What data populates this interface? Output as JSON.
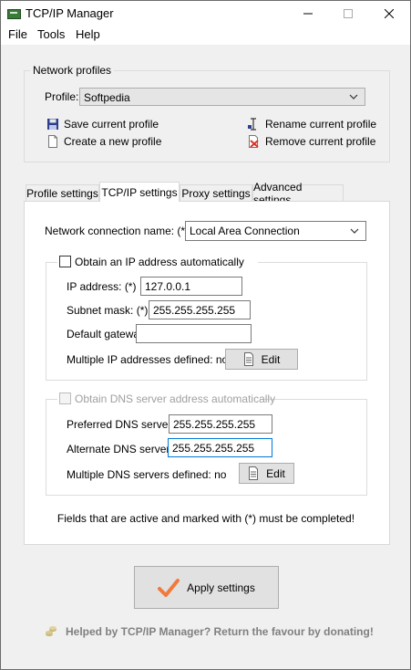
{
  "window": {
    "title": "TCP/IP Manager"
  },
  "menu": {
    "file": "File",
    "tools": "Tools",
    "help": "Help"
  },
  "profiles": {
    "group_title": "Network profiles",
    "profile_label": "Profile:",
    "profile_value": "Softpedia",
    "save": "Save current profile",
    "create": "Create a new profile",
    "rename": "Rename current profile",
    "remove": "Remove current profile"
  },
  "tabs": [
    {
      "label": "Profile settings"
    },
    {
      "label": "TCP/IP settings"
    },
    {
      "label": "Proxy settings"
    },
    {
      "label": "Advanced settings"
    }
  ],
  "tcpip": {
    "connection_label": "Network connection name: (*)",
    "connection_value": "Local Area Connection",
    "obtain_ip_label": "Obtain an IP address automatically",
    "ip_label": "IP address: (*)",
    "ip_value": "127.0.0.1",
    "subnet_label": "Subnet mask: (*)",
    "subnet_value": "255.255.255.255",
    "gateway_label": "Default gateway:",
    "gateway_value": "",
    "multi_ip_label": "Multiple IP addresses defined: no",
    "edit_ip_label": "Edit",
    "obtain_dns_label": "Obtain DNS server address automatically",
    "pref_dns_label": "Preferred DNS server:",
    "pref_dns_value": "255.255.255.255",
    "alt_dns_label": "Alternate DNS server:",
    "alt_dns_value": "255.255.255.255",
    "multi_dns_label": "Multiple DNS servers defined: no",
    "edit_dns_label": "Edit",
    "note": "Fields that are active and marked with (*) must be completed!"
  },
  "footer": {
    "apply_label": "Apply settings",
    "donate": "Helped by TCP/IP Manager? Return the favour by donating!"
  },
  "colors": {
    "apply_check": "#f07a3c",
    "remove_icon": "#d9342b",
    "focus_border": "#0078d7"
  }
}
